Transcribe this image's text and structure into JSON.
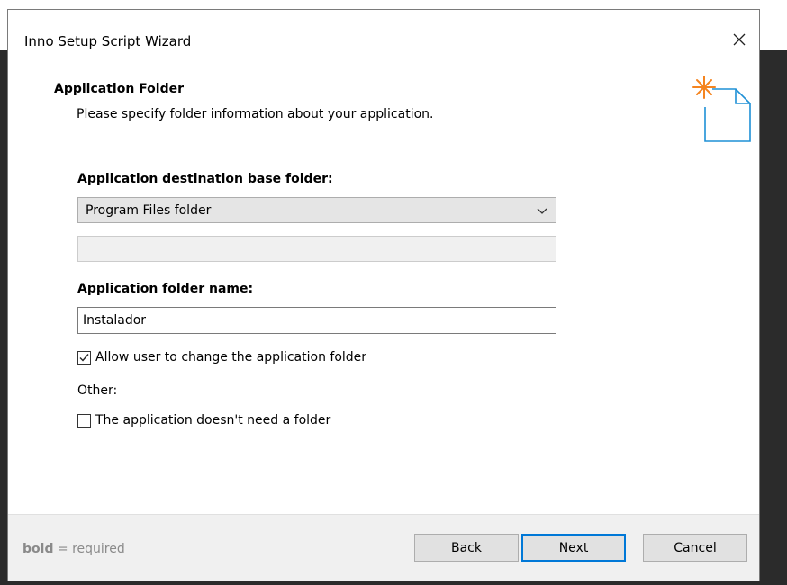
{
  "window": {
    "title": "Inno Setup Script Wizard"
  },
  "header": {
    "heading": "Application Folder",
    "description": "Please specify folder information about your application."
  },
  "form": {
    "base_folder_label": "Application destination base folder:",
    "base_folder_value": "Program Files folder",
    "custom_base_folder_value": "",
    "folder_name_label": "Application folder name:",
    "folder_name_value": "Instalador",
    "allow_change": {
      "label": "Allow user to change the application folder",
      "checked": true
    },
    "other_label": "Other:",
    "no_folder": {
      "label": "The application doesn't need a folder",
      "checked": false
    }
  },
  "footer": {
    "note_bold": "bold",
    "note_rest": " = required",
    "back_label": "Back",
    "next_label": "Next",
    "cancel_label": "Cancel"
  },
  "colors": {
    "accent": "#0078d7",
    "icon_blue": "#1e90d6",
    "icon_star": "#f5841f",
    "footer_bg": "#f0f0f0"
  }
}
